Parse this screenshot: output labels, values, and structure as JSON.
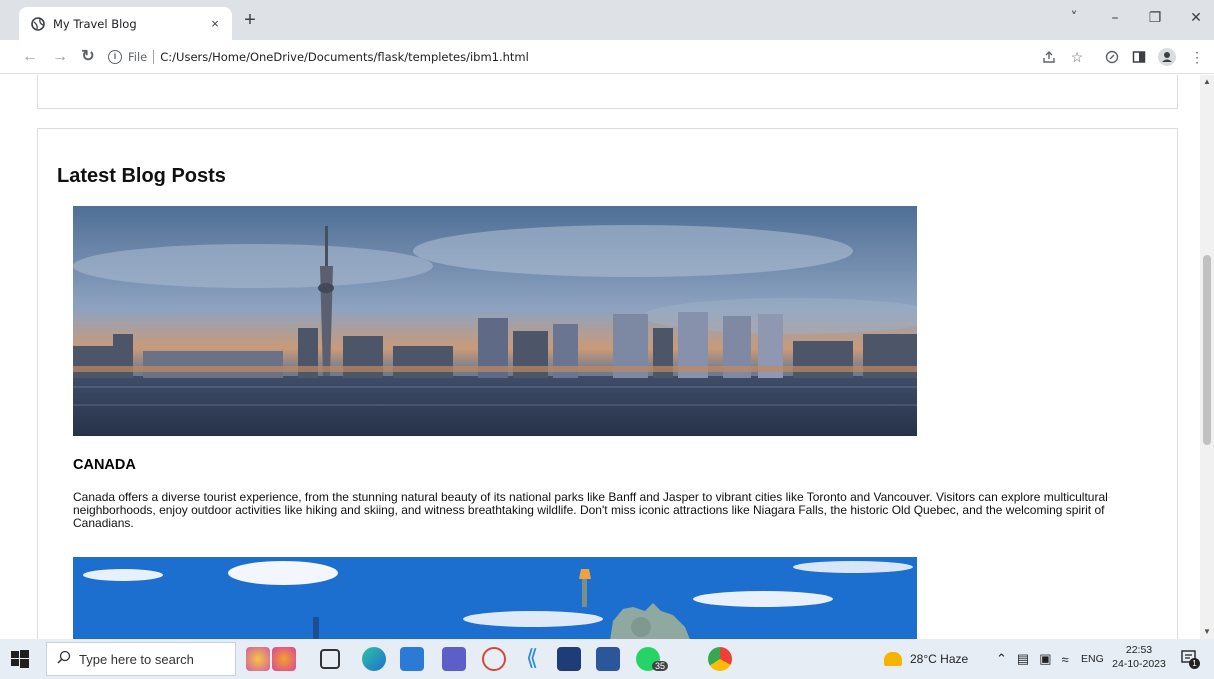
{
  "browser": {
    "tab_title": "My Travel Blog",
    "tab_close": "×",
    "new_tab": "+",
    "window_controls": [
      "˅",
      "–",
      "❐",
      "✕"
    ],
    "scheme_label": "File",
    "url": "C:/Users/Home/OneDrive/Documents/flask/templetes/ibm1.html"
  },
  "page": {
    "section_title": "Latest Blog Posts",
    "posts": [
      {
        "title": "CANADA",
        "body": "Canada offers a diverse tourist experience, from the stunning natural beauty of its national parks like Banff and Jasper to vibrant cities like Toronto and Vancouver. Visitors can explore multicultural neighborhoods, enjoy outdoor activities like hiking and skiing, and witness breathtaking wildlife. Don't miss iconic attractions like Niagara Falls, the historic Old Quebec, and the welcoming spirit of Canadians."
      }
    ]
  },
  "taskbar": {
    "search_placeholder": "Type here to search",
    "whatsapp_badge": "35",
    "weather": "28°C  Haze",
    "language": "ENG",
    "time": "22:53",
    "date": "24-10-2023",
    "notifications": "1"
  },
  "colors": {
    "tabstrip": "#dee1e6",
    "taskbar": "#e6edf5",
    "panel_border": "#dddddd"
  }
}
